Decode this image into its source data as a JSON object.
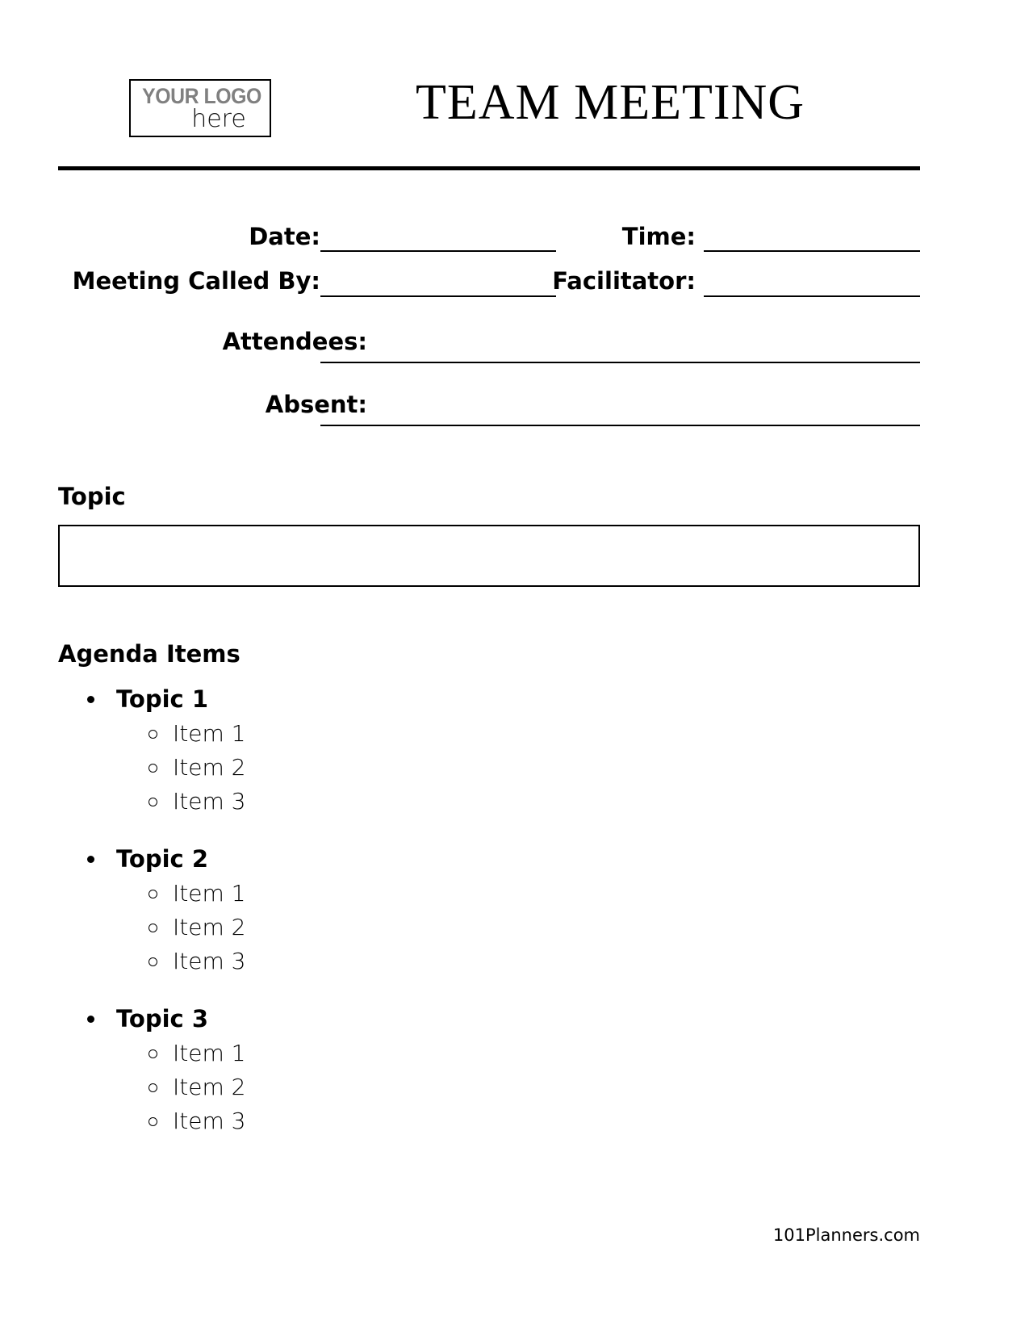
{
  "document": {
    "title": "TEAM MEETING",
    "logo": {
      "line1": "YOUR LOGO",
      "line2": "here",
      "line1_color": "#808080",
      "line2_color": "#111111"
    }
  },
  "form": {
    "fields": [
      {
        "label": "Date:",
        "value": ""
      },
      {
        "label": "Time:",
        "value": ""
      },
      {
        "label": "Meeting Called By:",
        "value": ""
      },
      {
        "label": "Facilitator:",
        "value": ""
      },
      {
        "label": "Attendees:",
        "value": ""
      },
      {
        "label": "Absent:",
        "value": ""
      }
    ]
  },
  "topic_section": {
    "heading": "Topic",
    "value": ""
  },
  "agenda_section": {
    "heading": "Agenda Items",
    "topics": [
      {
        "label": "Topic 1",
        "items": [
          "Item 1",
          "Item 2",
          "Item 3"
        ]
      },
      {
        "label": "Topic 2",
        "items": [
          "Item 1",
          "Item 2",
          "Item 3"
        ]
      },
      {
        "label": "Topic 3",
        "items": [
          "Item 1",
          "Item 2",
          "Item 3"
        ]
      }
    ]
  },
  "footer": {
    "credit": "101Planners.com"
  },
  "colors": {
    "ink": "#000000",
    "paper": "#ffffff",
    "logo_gray": "#808080"
  }
}
